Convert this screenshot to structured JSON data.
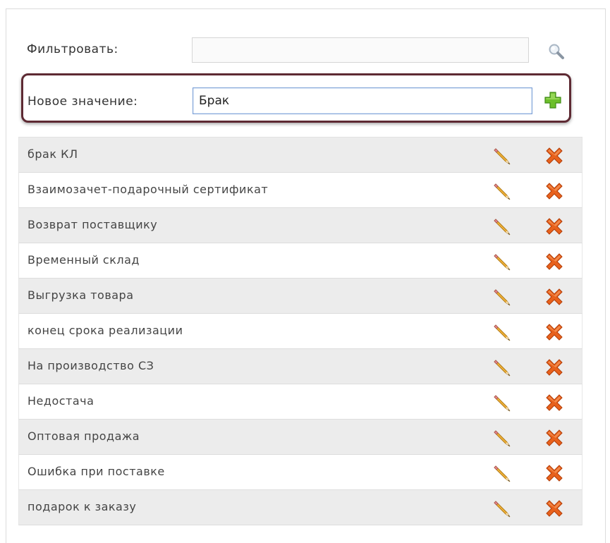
{
  "filter": {
    "label": "Фильтровать:",
    "value": "",
    "placeholder": ""
  },
  "new_value": {
    "label": "Новое значение:",
    "value": "Брак"
  },
  "icons": {
    "search": "search-icon",
    "add": "plus-icon",
    "edit": "pencil-icon",
    "delete": "delete-x-icon"
  },
  "colors": {
    "highlight_border": "#5e2a33",
    "row_alt_bg": "#ececec",
    "add_green": "#6cbf2a",
    "delete_orange": "#e8611c",
    "pencil_yellow": "#f3b43a"
  },
  "items": [
    {
      "label": "брак КЛ"
    },
    {
      "label": "Взаимозачет-подарочный сертификат"
    },
    {
      "label": "Возврат поставщику"
    },
    {
      "label": "Временный склад"
    },
    {
      "label": "Выгрузка товара"
    },
    {
      "label": "конец срока реализации"
    },
    {
      "label": "На производство СЗ"
    },
    {
      "label": "Недостача"
    },
    {
      "label": "Оптовая продажа"
    },
    {
      "label": "Ошибка при поставке"
    },
    {
      "label": "подарок к заказу"
    }
  ]
}
